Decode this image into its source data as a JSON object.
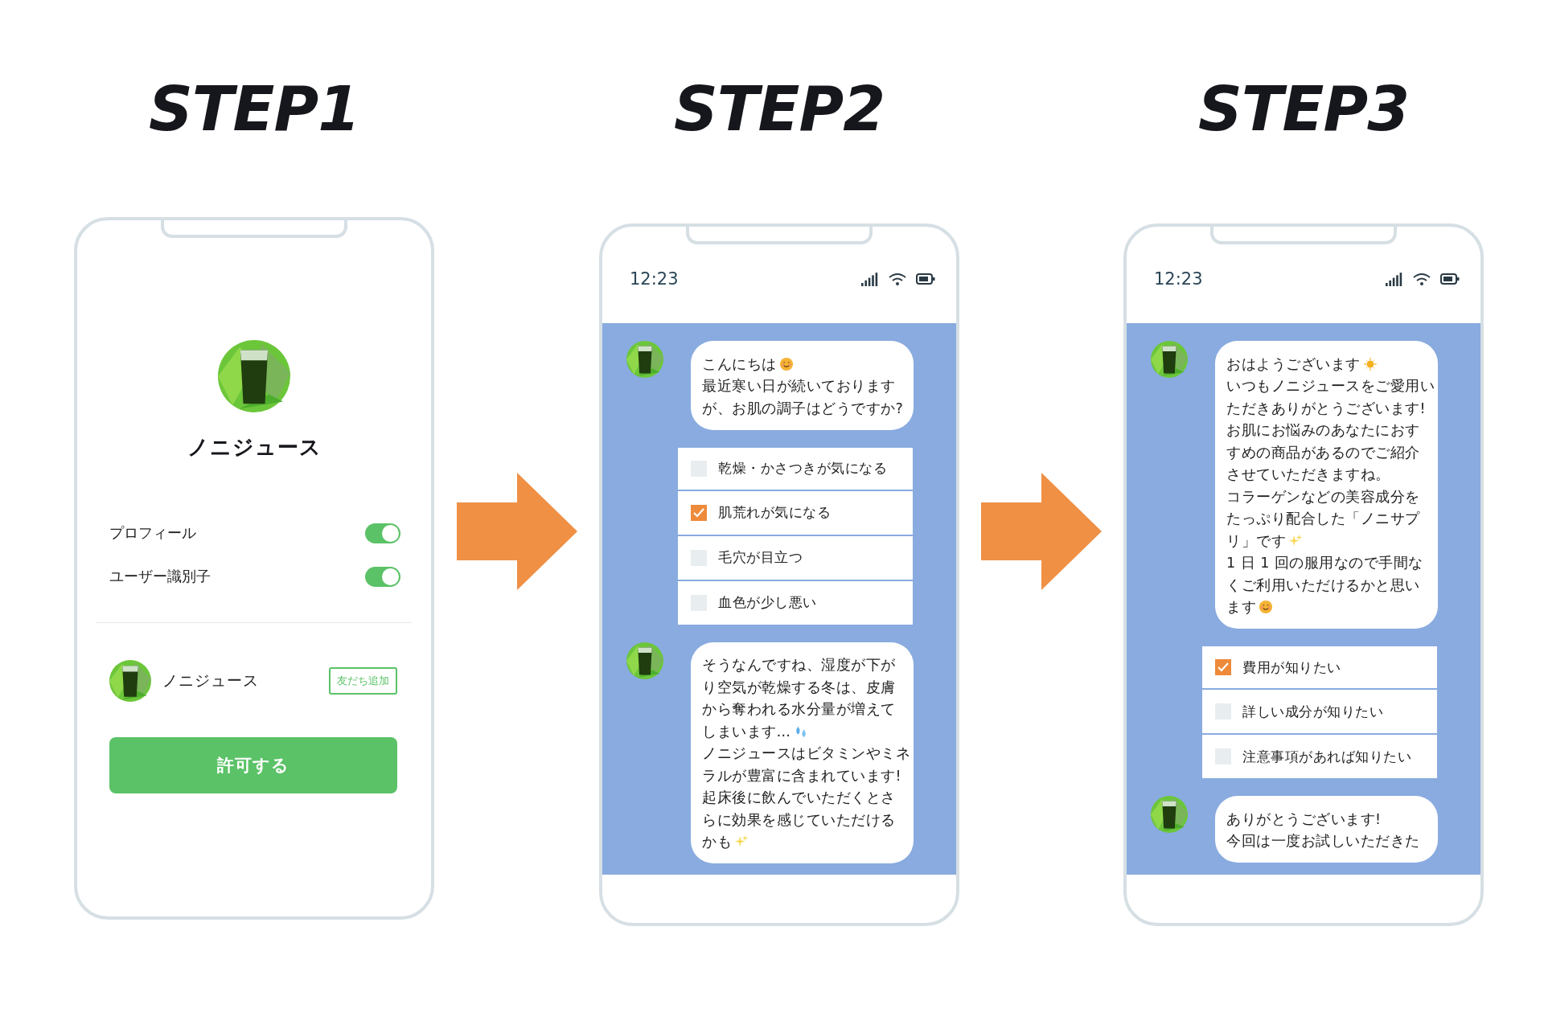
{
  "steps": [
    {
      "title": "STEP1",
      "screen": {
        "kind": "permission",
        "account_name": "ノニジュース",
        "permissions": [
          {
            "label": "プロフィール",
            "on": true
          },
          {
            "label": "ユーザー識別子",
            "on": true
          }
        ],
        "account": {
          "name": "ノニジュース",
          "add_button": "友だち追加"
        },
        "permit_button": "許可する"
      }
    },
    {
      "title": "STEP2",
      "screen": {
        "kind": "chat",
        "time": "12:23",
        "items": [
          {
            "kind": "message",
            "lines": [
              {
                "kind": "smile",
                "text": "こんにちは"
              },
              {
                "kind": "plain",
                "text": "最近寒い日が続いております"
              },
              {
                "kind": "plain",
                "text": "が、お肌の調子はどうですか?"
              }
            ]
          },
          {
            "kind": "options",
            "options": [
              {
                "label": "乾燥・かさつきが気になる",
                "checked": false
              },
              {
                "label": "肌荒れが気になる",
                "checked": true
              },
              {
                "label": "毛穴が目立つ",
                "checked": false
              },
              {
                "label": "血色が少し悪い",
                "checked": false
              }
            ]
          },
          {
            "kind": "message",
            "lines": [
              {
                "kind": "plain",
                "text": "そうなんですね、湿度が下が"
              },
              {
                "kind": "plain",
                "text": "り空気が乾燥する冬は、皮膚"
              },
              {
                "kind": "plain",
                "text": "から奪われる水分量が増えて"
              },
              {
                "kind": "sweat",
                "text": "しまいます…"
              },
              {
                "kind": "plain",
                "text": "ノニジュースはビタミンやミネ"
              },
              {
                "kind": "plain",
                "text": "ラルが豊富に含まれています!"
              },
              {
                "kind": "plain",
                "text": "起床後に飲んでいただくとさ"
              },
              {
                "kind": "plain",
                "text": "らに効果を感じていただける"
              },
              {
                "kind": "sparkles",
                "text": "かも"
              }
            ]
          }
        ]
      }
    },
    {
      "title": "STEP3",
      "screen": {
        "kind": "chat",
        "time": "12:23",
        "items": [
          {
            "kind": "message",
            "lines": [
              {
                "kind": "sun",
                "text": "おはようございます"
              },
              {
                "kind": "plain",
                "text": "いつもノニジュースをご愛用い"
              },
              {
                "kind": "plain",
                "text": "ただきありがとうございます!"
              },
              {
                "kind": "plain",
                "text": "お肌にお悩みのあなたにおす"
              },
              {
                "kind": "plain",
                "text": "すめの商品があるのでご紹介"
              },
              {
                "kind": "plain",
                "text": "させていただきますね。"
              },
              {
                "kind": "plain",
                "text": "コラーゲンなどの美容成分を"
              },
              {
                "kind": "plain",
                "text": "たっぷり配合した「ノニサプ"
              },
              {
                "kind": "sparkles",
                "text": "リ」です"
              },
              {
                "kind": "plain",
                "text": "1 日 1 回の服用なので手間な"
              },
              {
                "kind": "plain",
                "text": "くご利用いただけるかと思い"
              },
              {
                "kind": "smile",
                "text": "ます"
              }
            ]
          },
          {
            "kind": "options",
            "options": [
              {
                "label": "費用が知りたい",
                "checked": true
              },
              {
                "label": "詳しい成分が知りたい",
                "checked": false
              },
              {
                "label": "注意事項があれば知りたい",
                "checked": false
              }
            ]
          },
          {
            "kind": "message",
            "lines": [
              {
                "kind": "plain",
                "text": "ありがとうございます!"
              },
              {
                "kind": "plain",
                "text": "今回は一度お試しいただきた"
              }
            ]
          }
        ]
      }
    }
  ]
}
